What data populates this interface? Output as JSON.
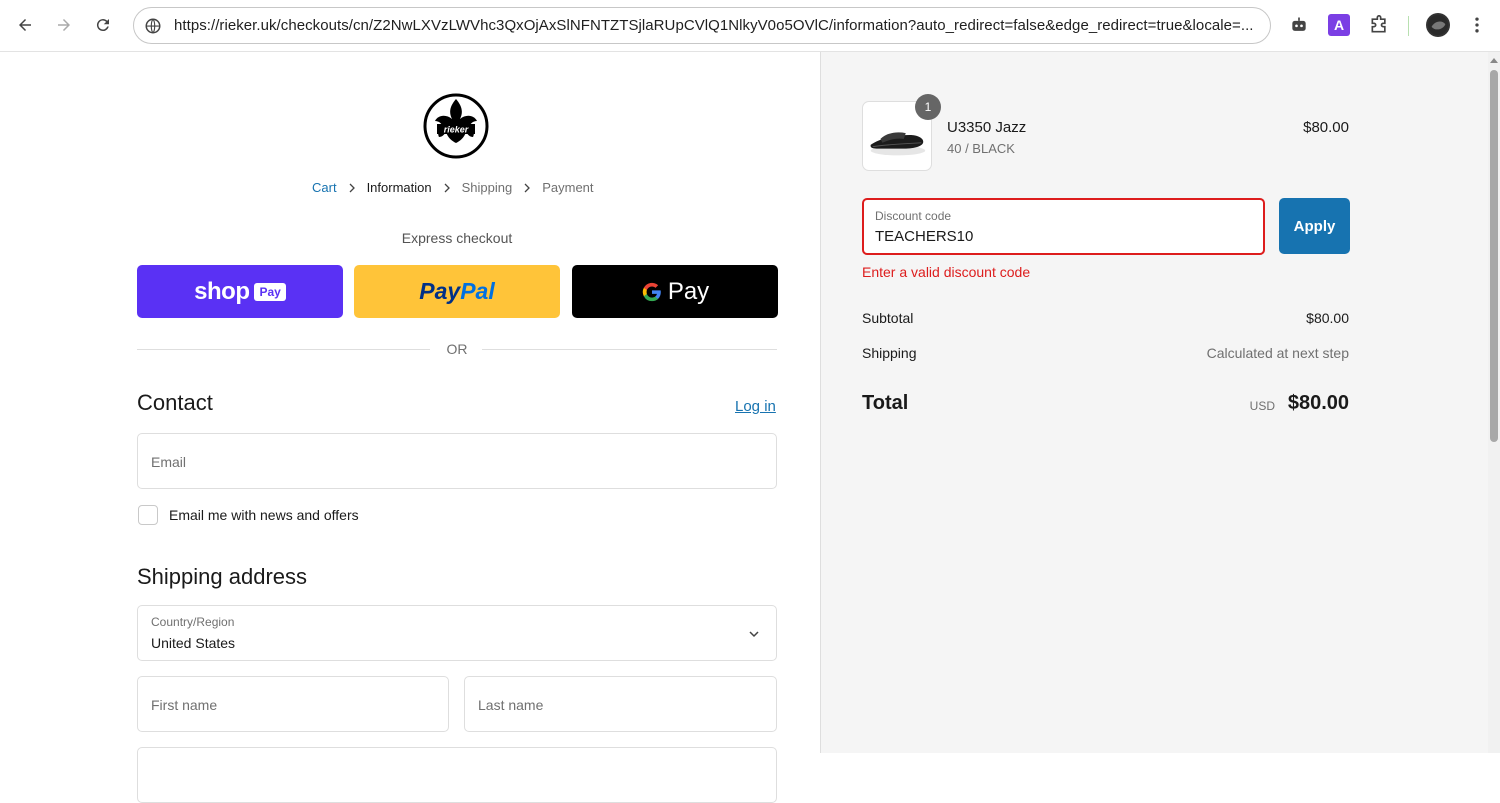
{
  "browser": {
    "url": "https://rieker.uk/checkouts/cn/Z2NwLXVzLWVhc3QxOjAxSlNFNTZTSjlaRUpCVlQ1NlkyV0o5OVlC/information?auto_redirect=false&edge_redirect=true&locale=...",
    "icons": [
      "back-icon",
      "forward-icon",
      "reload-icon",
      "site-info-icon",
      "robot-extension-icon",
      "a-extension-icon",
      "puzzle-extensions-icon",
      "profile-avatar",
      "more-menu-icon"
    ],
    "ext_a_label": "A"
  },
  "logo": {
    "text": "rieker"
  },
  "breadcrumb": {
    "items": [
      "Cart",
      "Information",
      "Shipping",
      "Payment"
    ]
  },
  "express": {
    "label": "Express checkout",
    "shop_pay": "shop",
    "shop_pay_badge": "Pay",
    "paypal_a": "Pay",
    "paypal_b": "Pal",
    "gpay": "Pay"
  },
  "or_label": "OR",
  "contact": {
    "heading": "Contact",
    "login": "Log in",
    "email_placeholder": "Email",
    "newsletter_label": "Email me with news and offers"
  },
  "shipping": {
    "heading": "Shipping address",
    "country_label": "Country/Region",
    "country_value": "United States",
    "first_name": "First name",
    "last_name": "Last name"
  },
  "order": {
    "quantity": "1",
    "item_name": "U3350 Jazz",
    "item_variant": "40 / BLACK",
    "item_price": "$80.00",
    "discount_label": "Discount code",
    "discount_value": "TEACHERS10",
    "apply": "Apply",
    "error": "Enter a valid discount code",
    "subtotal_label": "Subtotal",
    "subtotal_value": "$80.00",
    "shipping_label": "Shipping",
    "shipping_value": "Calculated at next step",
    "total_label": "Total",
    "currency": "USD",
    "total_value": "$80.00"
  },
  "colors": {
    "accent": "#1773b0",
    "error": "#dd1d1d",
    "shop_pay": "#5a31f4",
    "paypal": "#ffc439",
    "gpay": "#000000"
  }
}
